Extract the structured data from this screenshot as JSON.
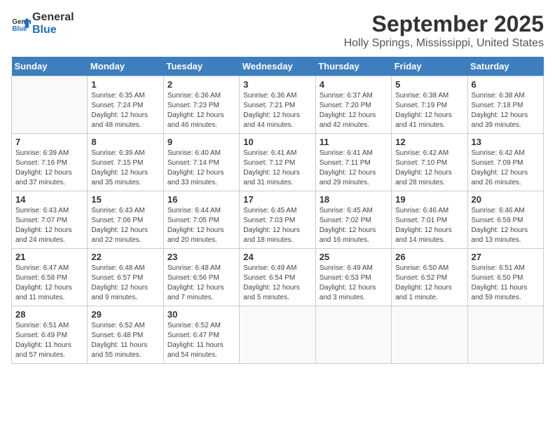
{
  "header": {
    "logo_line1": "General",
    "logo_line2": "Blue",
    "month": "September 2025",
    "location": "Holly Springs, Mississippi, United States"
  },
  "weekdays": [
    "Sunday",
    "Monday",
    "Tuesday",
    "Wednesday",
    "Thursday",
    "Friday",
    "Saturday"
  ],
  "weeks": [
    [
      {
        "day": "",
        "sunrise": "",
        "sunset": "",
        "daylight": ""
      },
      {
        "day": "1",
        "sunrise": "Sunrise: 6:35 AM",
        "sunset": "Sunset: 7:24 PM",
        "daylight": "Daylight: 12 hours and 48 minutes."
      },
      {
        "day": "2",
        "sunrise": "Sunrise: 6:36 AM",
        "sunset": "Sunset: 7:23 PM",
        "daylight": "Daylight: 12 hours and 46 minutes."
      },
      {
        "day": "3",
        "sunrise": "Sunrise: 6:36 AM",
        "sunset": "Sunset: 7:21 PM",
        "daylight": "Daylight: 12 hours and 44 minutes."
      },
      {
        "day": "4",
        "sunrise": "Sunrise: 6:37 AM",
        "sunset": "Sunset: 7:20 PM",
        "daylight": "Daylight: 12 hours and 42 minutes."
      },
      {
        "day": "5",
        "sunrise": "Sunrise: 6:38 AM",
        "sunset": "Sunset: 7:19 PM",
        "daylight": "Daylight: 12 hours and 41 minutes."
      },
      {
        "day": "6",
        "sunrise": "Sunrise: 6:38 AM",
        "sunset": "Sunset: 7:18 PM",
        "daylight": "Daylight: 12 hours and 39 minutes."
      }
    ],
    [
      {
        "day": "7",
        "sunrise": "Sunrise: 6:39 AM",
        "sunset": "Sunset: 7:16 PM",
        "daylight": "Daylight: 12 hours and 37 minutes."
      },
      {
        "day": "8",
        "sunrise": "Sunrise: 6:39 AM",
        "sunset": "Sunset: 7:15 PM",
        "daylight": "Daylight: 12 hours and 35 minutes."
      },
      {
        "day": "9",
        "sunrise": "Sunrise: 6:40 AM",
        "sunset": "Sunset: 7:14 PM",
        "daylight": "Daylight: 12 hours and 33 minutes."
      },
      {
        "day": "10",
        "sunrise": "Sunrise: 6:41 AM",
        "sunset": "Sunset: 7:12 PM",
        "daylight": "Daylight: 12 hours and 31 minutes."
      },
      {
        "day": "11",
        "sunrise": "Sunrise: 6:41 AM",
        "sunset": "Sunset: 7:11 PM",
        "daylight": "Daylight: 12 hours and 29 minutes."
      },
      {
        "day": "12",
        "sunrise": "Sunrise: 6:42 AM",
        "sunset": "Sunset: 7:10 PM",
        "daylight": "Daylight: 12 hours and 28 minutes."
      },
      {
        "day": "13",
        "sunrise": "Sunrise: 6:42 AM",
        "sunset": "Sunset: 7:09 PM",
        "daylight": "Daylight: 12 hours and 26 minutes."
      }
    ],
    [
      {
        "day": "14",
        "sunrise": "Sunrise: 6:43 AM",
        "sunset": "Sunset: 7:07 PM",
        "daylight": "Daylight: 12 hours and 24 minutes."
      },
      {
        "day": "15",
        "sunrise": "Sunrise: 6:43 AM",
        "sunset": "Sunset: 7:06 PM",
        "daylight": "Daylight: 12 hours and 22 minutes."
      },
      {
        "day": "16",
        "sunrise": "Sunrise: 6:44 AM",
        "sunset": "Sunset: 7:05 PM",
        "daylight": "Daylight: 12 hours and 20 minutes."
      },
      {
        "day": "17",
        "sunrise": "Sunrise: 6:45 AM",
        "sunset": "Sunset: 7:03 PM",
        "daylight": "Daylight: 12 hours and 18 minutes."
      },
      {
        "day": "18",
        "sunrise": "Sunrise: 6:45 AM",
        "sunset": "Sunset: 7:02 PM",
        "daylight": "Daylight: 12 hours and 16 minutes."
      },
      {
        "day": "19",
        "sunrise": "Sunrise: 6:46 AM",
        "sunset": "Sunset: 7:01 PM",
        "daylight": "Daylight: 12 hours and 14 minutes."
      },
      {
        "day": "20",
        "sunrise": "Sunrise: 6:46 AM",
        "sunset": "Sunset: 6:59 PM",
        "daylight": "Daylight: 12 hours and 13 minutes."
      }
    ],
    [
      {
        "day": "21",
        "sunrise": "Sunrise: 6:47 AM",
        "sunset": "Sunset: 6:58 PM",
        "daylight": "Daylight: 12 hours and 11 minutes."
      },
      {
        "day": "22",
        "sunrise": "Sunrise: 6:48 AM",
        "sunset": "Sunset: 6:57 PM",
        "daylight": "Daylight: 12 hours and 9 minutes."
      },
      {
        "day": "23",
        "sunrise": "Sunrise: 6:48 AM",
        "sunset": "Sunset: 6:56 PM",
        "daylight": "Daylight: 12 hours and 7 minutes."
      },
      {
        "day": "24",
        "sunrise": "Sunrise: 6:49 AM",
        "sunset": "Sunset: 6:54 PM",
        "daylight": "Daylight: 12 hours and 5 minutes."
      },
      {
        "day": "25",
        "sunrise": "Sunrise: 6:49 AM",
        "sunset": "Sunset: 6:53 PM",
        "daylight": "Daylight: 12 hours and 3 minutes."
      },
      {
        "day": "26",
        "sunrise": "Sunrise: 6:50 AM",
        "sunset": "Sunset: 6:52 PM",
        "daylight": "Daylight: 12 hours and 1 minute."
      },
      {
        "day": "27",
        "sunrise": "Sunrise: 6:51 AM",
        "sunset": "Sunset: 6:50 PM",
        "daylight": "Daylight: 11 hours and 59 minutes."
      }
    ],
    [
      {
        "day": "28",
        "sunrise": "Sunrise: 6:51 AM",
        "sunset": "Sunset: 6:49 PM",
        "daylight": "Daylight: 11 hours and 57 minutes."
      },
      {
        "day": "29",
        "sunrise": "Sunrise: 6:52 AM",
        "sunset": "Sunset: 6:48 PM",
        "daylight": "Daylight: 11 hours and 55 minutes."
      },
      {
        "day": "30",
        "sunrise": "Sunrise: 6:52 AM",
        "sunset": "Sunset: 6:47 PM",
        "daylight": "Daylight: 11 hours and 54 minutes."
      },
      {
        "day": "",
        "sunrise": "",
        "sunset": "",
        "daylight": ""
      },
      {
        "day": "",
        "sunrise": "",
        "sunset": "",
        "daylight": ""
      },
      {
        "day": "",
        "sunrise": "",
        "sunset": "",
        "daylight": ""
      },
      {
        "day": "",
        "sunrise": "",
        "sunset": "",
        "daylight": ""
      }
    ]
  ]
}
